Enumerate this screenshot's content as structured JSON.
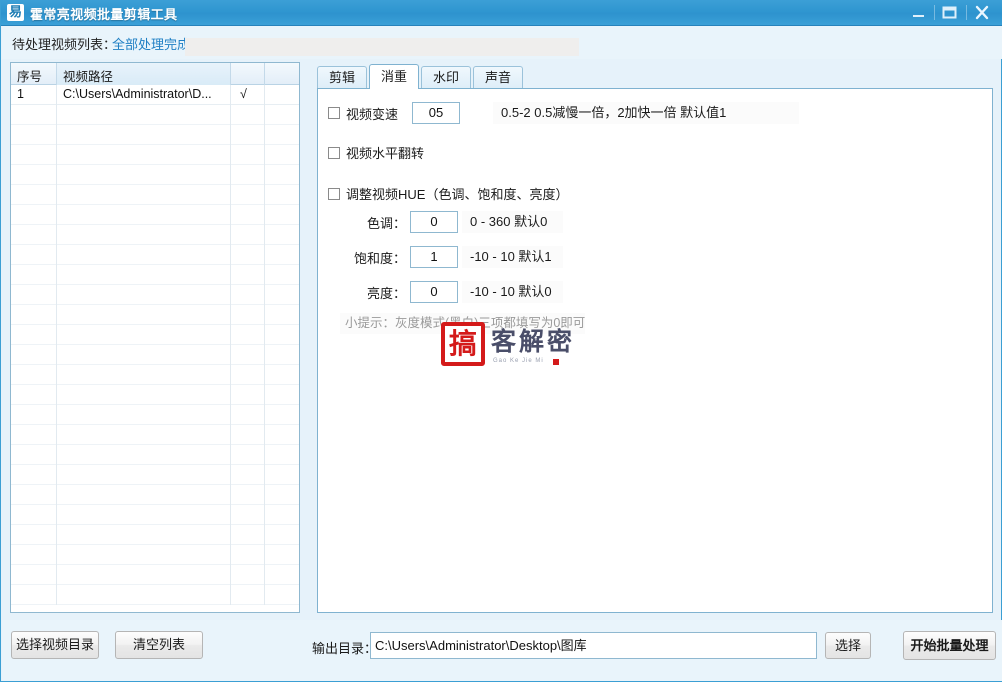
{
  "window": {
    "title": "霍常亮视频批量剪辑工具",
    "icon": "易",
    "controls": {
      "minimize": "minimize-icon",
      "maximize": "maximize-icon",
      "close": "close-icon"
    }
  },
  "top": {
    "list_label": "待处理视频列表：",
    "status_text": "全部处理完成！",
    "accent_color": "#1f7fc4"
  },
  "list": {
    "columns": [
      "序号",
      "视频路径",
      "",
      ""
    ],
    "rows": [
      {
        "index": "1",
        "path": "C:\\Users\\Administrator\\D...",
        "check": "√",
        "extra": ""
      }
    ],
    "empty_row_count": 25
  },
  "tabs": {
    "items": [
      {
        "label": "剪辑",
        "active": false
      },
      {
        "label": "消重",
        "active": true
      },
      {
        "label": "水印",
        "active": false
      },
      {
        "label": "声音",
        "active": false
      }
    ]
  },
  "dedup_panel": {
    "speed": {
      "checkbox_checked": false,
      "label": "视频变速",
      "value": "05",
      "hint": "0.5-2  0.5减慢一倍，2加快一倍 默认值1"
    },
    "flip": {
      "checkbox_checked": false,
      "label": "视频水平翻转"
    },
    "hue": {
      "checkbox_checked": false,
      "label": "调整视频HUE（色调、饱和度、亮度）",
      "fields": [
        {
          "label": "色调：",
          "value": "0",
          "hint": "0 - 360 默认0"
        },
        {
          "label": "饱和度：",
          "value": "1",
          "hint": "-10 - 10 默认1"
        },
        {
          "label": "亮度：",
          "value": "0",
          "hint": "-10 - 10 默认0"
        }
      ]
    },
    "tip": "小提示：灰度模式(黑白)三项都填写为0即可"
  },
  "watermark": {
    "seal_char": "搞",
    "text": "客解密",
    "subtext": "Gao Ke Jie Mi",
    "seal_color": "#d41a1a"
  },
  "bottom": {
    "choose_dir_button": "选择视频目录",
    "clear_list_button": "清空列表",
    "output_label": "输出目录：",
    "output_path": "C:\\Users\\Administrator\\Desktop\\图库",
    "browse_button": "选择",
    "start_button": "开始批量处理"
  }
}
